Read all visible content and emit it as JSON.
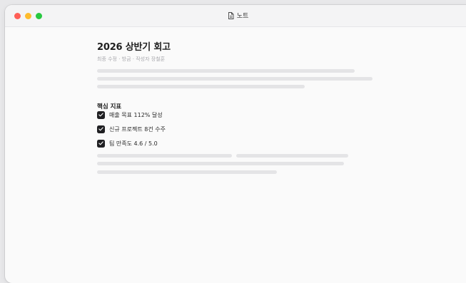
{
  "window": {
    "title": "노트"
  },
  "document": {
    "heading": "2026 상반기 회고",
    "meta": "최종 수정 · 방금 · 작성자 장철훈",
    "section_title": "핵심 지표",
    "checklist": [
      {
        "label": "매출 목표 112% 달성",
        "checked": true
      },
      {
        "label": "신규 프로젝트 8건 수주",
        "checked": true
      },
      {
        "label": "팀 만족도 4.6 / 5.0",
        "checked": true
      }
    ]
  },
  "colors": {
    "close": "#ff5f57",
    "minimize": "#febc2e",
    "maximize": "#28c840",
    "checkbox": "#1f1f22",
    "placeholder_line": "#e4e4e6"
  }
}
